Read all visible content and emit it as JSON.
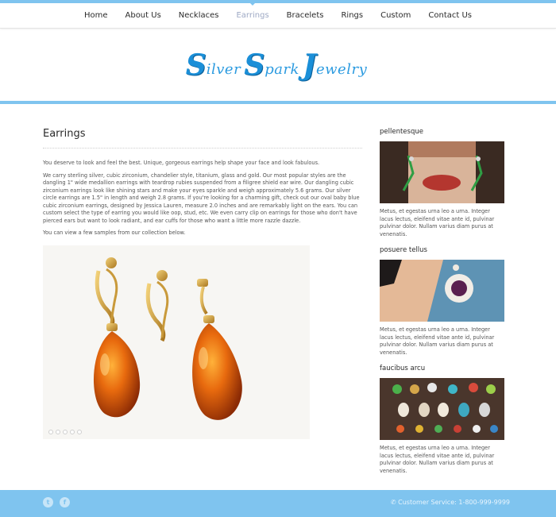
{
  "nav": {
    "items": [
      {
        "label": "Home",
        "active": false
      },
      {
        "label": "About Us",
        "active": false
      },
      {
        "label": "Necklaces",
        "active": false
      },
      {
        "label": "Earrings",
        "active": true
      },
      {
        "label": "Bracelets",
        "active": false
      },
      {
        "label": "Rings",
        "active": false
      },
      {
        "label": "Custom",
        "active": false
      },
      {
        "label": "Contact Us",
        "active": false
      }
    ]
  },
  "logo": {
    "text": "SilverSparkJewelry"
  },
  "main": {
    "title": "Earrings",
    "p1": "You deserve to look and feel the best. Unique, gorgeous earrings help shape your face and look fabulous.",
    "p2": "We carry sterling silver, cubic zirconium, chandelier style, titanium, glass and gold. Our most popular styles are the dangling 1\" wide medallion earrings with teardrop rubies suspended from a filigree shield ear wire. Our dangling cubic zirconium earrings look like shining stars and make your eyes sparkle and weigh approximately 5.6 grams. Our silver circle earrings are 1.5\" in length and weigh 2.8 grams. If you're looking for a charming gift, check out our oval baby blue cubic zirconium earrings, designed by Jessica Lauren, measure 2.0 inches and are remarkably light on the ears. You can custom select the type of earring you would like    oop, stud, etc. We even carry clip on earrings for those who don't have pierced ears but want to look radiant, and ear cuffs for those who want a little more razzle dazzle.",
    "p3": "You can view a few samples from our collection below.",
    "slider_dots": 5
  },
  "sidebar": [
    {
      "title": "pellentesque",
      "text": "Metus, et egestas urna leo a urna. Integer lacus lectus, eleifend vitae ante id, pulvinar pulvinar dolor. Nullam varius diam purus at venenatis."
    },
    {
      "title": "posuere tellus",
      "text": "Metus, et egestas urna leo a urna. Integer lacus lectus, eleifend vitae ante id, pulvinar pulvinar dolor. Nullam varius diam purus at venenatis."
    },
    {
      "title": "faucibus arcu",
      "text": "Metus, et egestas urna leo a urna. Integer lacus lectus, eleifend vitae ante id, pulvinar pulvinar dolor. Nullam varius diam purus at venenatis."
    }
  ],
  "footer": {
    "service": "Customer Service: 1-800-999-9999",
    "social": [
      "twitter-icon",
      "facebook-icon"
    ]
  },
  "colors": {
    "accent": "#7fc4ef",
    "logo": "#1b8fd8",
    "text": "#555555"
  }
}
